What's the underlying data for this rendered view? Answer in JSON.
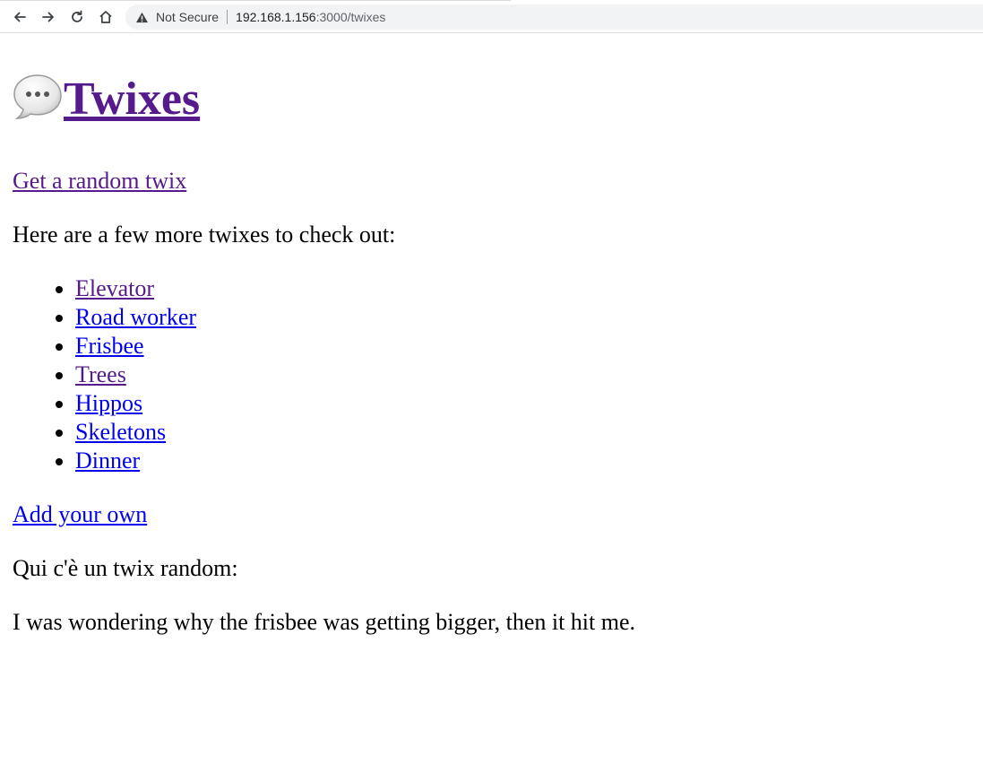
{
  "browser": {
    "security_label": "Not Secure",
    "url_host": "192.168.1.156",
    "url_path": ":3000/twixes"
  },
  "header": {
    "title": "Twixes"
  },
  "main": {
    "random_link": "Get a random twix",
    "intro": "Here are a few more twixes to check out:",
    "twixes": [
      {
        "label": "Elevator"
      },
      {
        "label": "Road worker"
      },
      {
        "label": "Frisbee"
      },
      {
        "label": "Trees"
      },
      {
        "label": "Hippos"
      },
      {
        "label": "Skeletons"
      },
      {
        "label": "Dinner"
      }
    ],
    "add_link": "Add your own",
    "random_heading": "Qui c'è un twix random:",
    "random_joke": "I was wondering why the frisbee was getting bigger, then it hit me."
  },
  "colors": {
    "link": "#0000ee",
    "visited_link": "#551a8b"
  }
}
